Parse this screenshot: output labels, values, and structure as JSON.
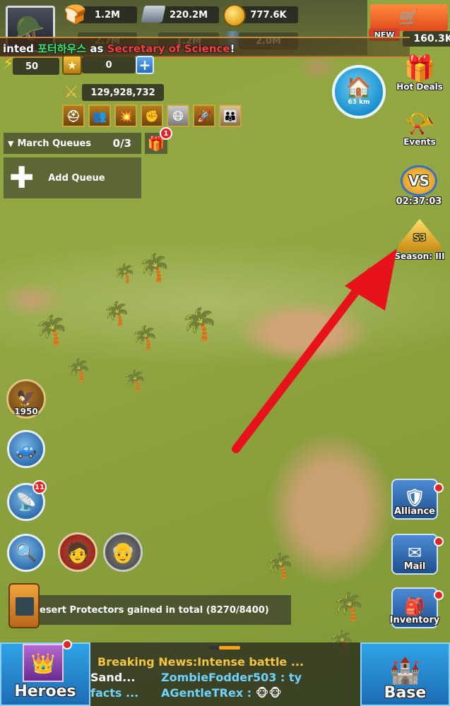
{
  "resources": [
    {
      "icon": "bread-icon",
      "value": "1.2M"
    },
    {
      "icon": "steel-icon",
      "value": "220.2M"
    },
    {
      "icon": "gold-coin-icon",
      "value": "777.6K"
    }
  ],
  "resources_row2": [
    {
      "icon": "bread-icon",
      "value": "2.7M"
    },
    {
      "icon": "steel-icon",
      "value": "1.2M"
    },
    {
      "icon": "oil-barrel-icon",
      "value": "2.0M"
    }
  ],
  "premium": {
    "value": "160.3K",
    "badge": "NEW"
  },
  "toast": {
    "prefix": "inted ",
    "player": "포터하우스",
    "middle": " as ",
    "role": "Secretary of Science",
    "suffix": "!"
  },
  "energy": {
    "value": "50"
  },
  "stars": {
    "value": "0",
    "plus": "+"
  },
  "power": {
    "value": "129,928,732"
  },
  "buffs": [
    "helmet",
    "soldiers",
    "explosion",
    "fist",
    "gas-mask",
    "missiles",
    "soldiers-group"
  ],
  "march": {
    "label": "March Queues",
    "count": "0/3",
    "add_label": "Add Queue",
    "gift_badge": "1"
  },
  "home": {
    "distance": "63 km"
  },
  "right_menu": {
    "hot_deals": "Hot Deals",
    "events": "Events",
    "vs_timer": "02:37:03",
    "vs_label": "VS",
    "season_label": "Season: III",
    "season_num": "S3"
  },
  "left_menu": {
    "rank_value": "1950",
    "radar_badge": "11"
  },
  "side_buttons": [
    {
      "label": "Alliance"
    },
    {
      "label": "Mail"
    },
    {
      "label": "Inventory"
    }
  ],
  "quest": {
    "text": "esert Protectors gained in total (8270/8400)"
  },
  "news": {
    "headline": "Breaking News:Intense battle ...",
    "chat1_left": "Sand...",
    "chat1_user": "ZombieFodder503",
    "chat1_msg": " : ty",
    "chat2_left": "facts ...",
    "chat2_user": "AGentleTRex",
    "chat2_msg": " : "
  },
  "bottom": {
    "heroes": "Heroes",
    "base": "Base"
  },
  "colors": {
    "accent_green": "#3ee26a",
    "accent_red": "#ff3b3b",
    "news_yellow": "#f4c542",
    "chat_blue": "#6fd3ff"
  }
}
